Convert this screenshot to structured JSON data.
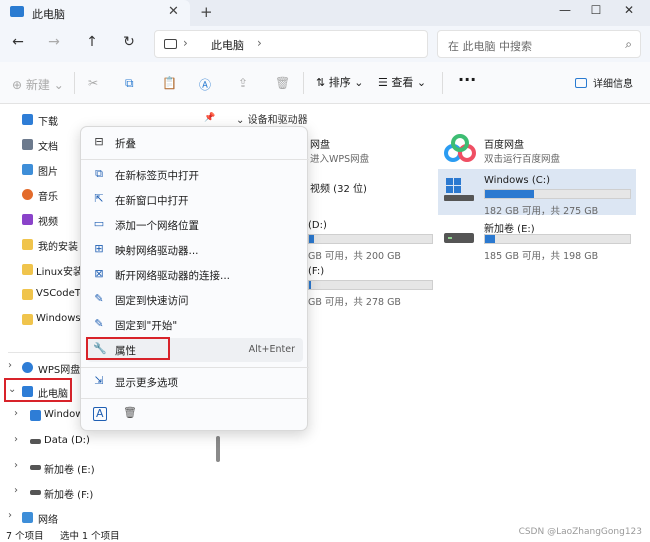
{
  "window": {
    "tab_title": "此电脑",
    "tab_close": "✕",
    "new_tab": "+",
    "min": "—",
    "max": "☐",
    "close": "✕"
  },
  "navbar": {
    "back": "←",
    "forward": "→",
    "up": "↑",
    "refresh": "↻",
    "breadcrumb_chevron": "›",
    "breadcrumb_item": "此电脑",
    "search_placeholder": "在 此电脑 中搜索",
    "search_icon": "⌕"
  },
  "toolbar": {
    "new_label": "新建",
    "sort_label": "排序",
    "view_label": "查看",
    "more_label": "···",
    "details_label": "详细信息"
  },
  "sidebar": {
    "items": [
      {
        "label": "下载",
        "color": "#2e7dd6"
      },
      {
        "label": "文档",
        "color": "#6c7a8d"
      },
      {
        "label": "图片",
        "color": "#3e8ed8"
      },
      {
        "label": "音乐",
        "color": "#e36b2b"
      },
      {
        "label": "视频",
        "color": "#8a43c9"
      },
      {
        "label": "我的安装",
        "color": "#f0c44c"
      },
      {
        "label": "Linux安装",
        "color": "#f0c44c"
      },
      {
        "label": "VSCodeTe",
        "color": "#f0c44c"
      },
      {
        "label": "Windows",
        "color": "#f0c44c"
      }
    ],
    "tree": [
      {
        "label": "WPS网盘",
        "chevron": "›",
        "color": "#2e7dd6"
      },
      {
        "label": "此电脑",
        "chevron": "⌄",
        "color": "#2e7dd6"
      },
      {
        "label": "Window",
        "chevron": "›",
        "color": "#2e7dd6"
      },
      {
        "label": "Data (D:)",
        "chevron": "›",
        "color": "#555555"
      },
      {
        "label": "新加卷 (E:)",
        "chevron": "›",
        "color": "#555555"
      },
      {
        "label": "新加卷 (F:)",
        "chevron": "›",
        "color": "#555555"
      },
      {
        "label": "网络",
        "chevron": "›",
        "color": "#3e8ed8"
      }
    ]
  },
  "main": {
    "section_chevron": "⌄",
    "section_title": "设备和驱动器",
    "wps_name": "网盘",
    "wps_sub": "进入WPS网盘",
    "baidu_name": "百度网盘",
    "baidu_sub": "双击运行百度网盘",
    "video_folder": "视频 (32 位)",
    "drives": [
      {
        "name": "Windows (C:)",
        "info": "182 GB 可用，共 275 GB",
        "used_fraction": 0.34
      },
      {
        "name": "(D:)",
        "info": "GB 可用，共 200 GB",
        "used_fraction": 0.04
      },
      {
        "name": "新加卷 (E:)",
        "info": "185 GB 可用，共 198 GB",
        "used_fraction": 0.07
      },
      {
        "name": "(F:)",
        "info": "GB 可用，共 278 GB",
        "used_fraction": 0.02
      }
    ]
  },
  "context_menu": {
    "items": [
      {
        "label": "折叠",
        "icon": "⊟"
      },
      {
        "label": "在新标签页中打开",
        "icon": "⧉"
      },
      {
        "label": "在新窗口中打开",
        "icon": "⇱"
      },
      {
        "label": "添加一个网络位置",
        "icon": "▭"
      },
      {
        "label": "映射网络驱动器...",
        "icon": "⊞"
      },
      {
        "label": "断开网络驱动器的连接...",
        "icon": "⊠"
      },
      {
        "label": "固定到快速访问",
        "icon": "✎"
      },
      {
        "label": "固定到\"开始\"",
        "icon": "✎"
      },
      {
        "label": "属性",
        "icon": "🔧",
        "shortcut": "Alt+Enter"
      },
      {
        "label": "显示更多选项",
        "icon": "⇲"
      }
    ],
    "bottom_icons": [
      "A",
      "🗑"
    ]
  },
  "status": {
    "count": "7 个项目",
    "selected": "选中 1 个项目"
  },
  "watermark": "CSDN @LaoZhangGong123"
}
